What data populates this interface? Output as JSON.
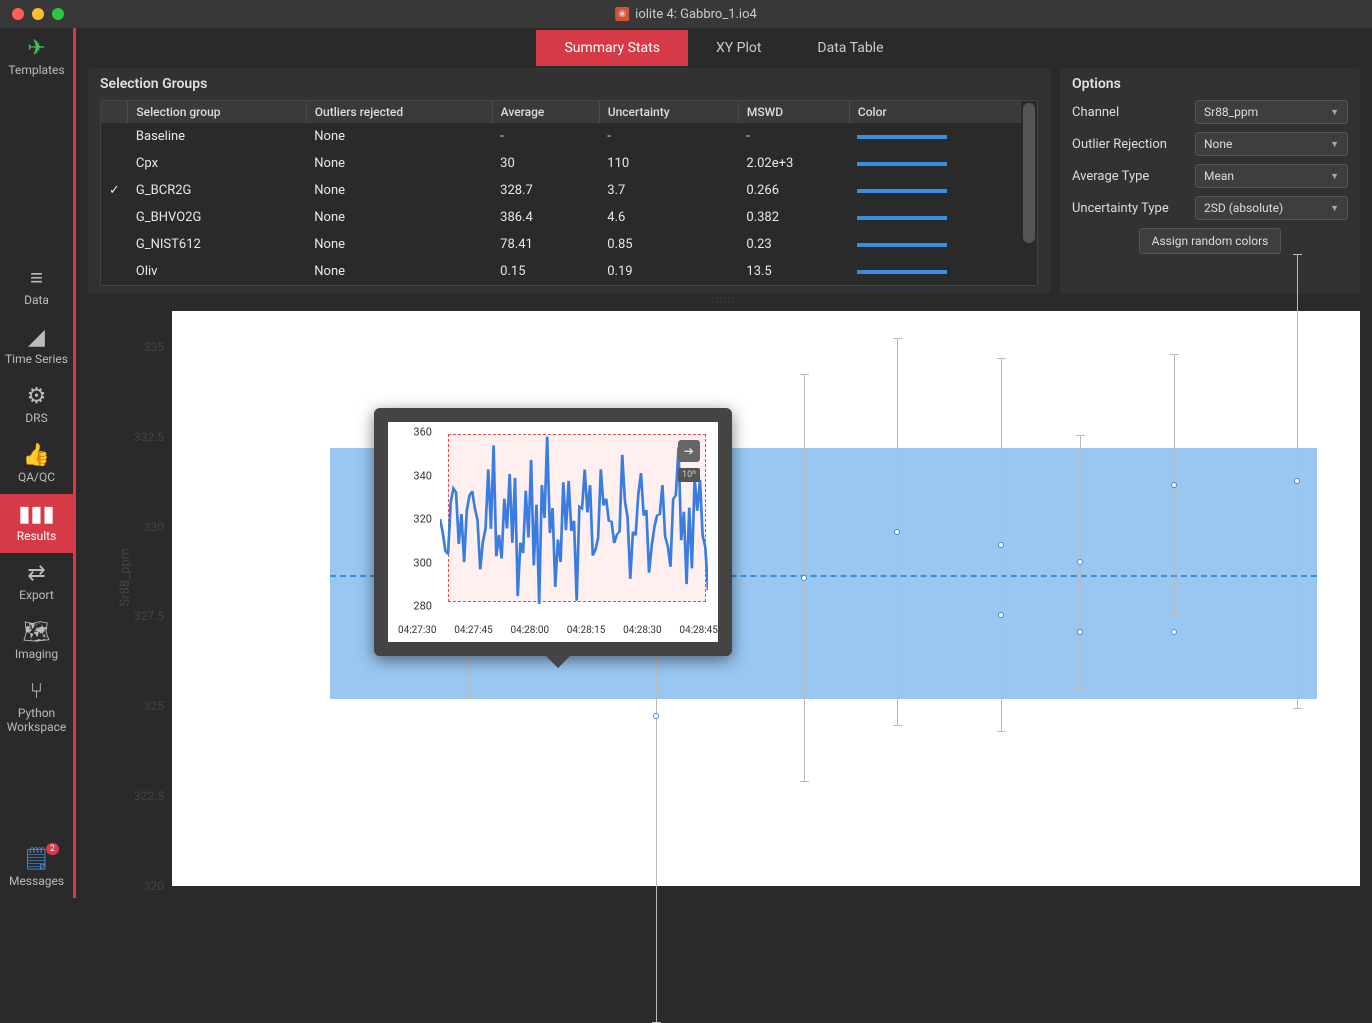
{
  "window": {
    "title": "iolite 4: Gabbro_1.io4"
  },
  "sidebar": {
    "items": [
      {
        "label": "Templates",
        "icon": "send"
      },
      {
        "label": "Data",
        "icon": "database"
      },
      {
        "label": "Time Series",
        "icon": "chart-area"
      },
      {
        "label": "DRS",
        "icon": "gear"
      },
      {
        "label": "QA/QC",
        "icon": "thumbs-up"
      },
      {
        "label": "Results",
        "icon": "bar-chart"
      },
      {
        "label": "Export",
        "icon": "exchange"
      },
      {
        "label": "Imaging",
        "icon": "map"
      },
      {
        "label": "Python Workspace",
        "icon": "code-fork"
      }
    ],
    "messages": {
      "label": "Messages",
      "badge": "2"
    }
  },
  "tabs": [
    {
      "label": "Summary Stats"
    },
    {
      "label": "XY Plot"
    },
    {
      "label": "Data Table"
    }
  ],
  "selection_groups": {
    "title": "Selection Groups",
    "headers": [
      "Selection group",
      "Outliers rejected",
      "Average",
      "Uncertainty",
      "MSWD",
      "Color"
    ],
    "rows": [
      {
        "checked": false,
        "group": "Baseline",
        "outliers": "None",
        "avg": "-",
        "unc": "-",
        "mswd": "-"
      },
      {
        "checked": false,
        "group": "Cpx",
        "outliers": "None",
        "avg": "30",
        "unc": "110",
        "mswd": "2.02e+3"
      },
      {
        "checked": true,
        "group": "G_BCR2G",
        "outliers": "None",
        "avg": "328.7",
        "unc": "3.7",
        "mswd": "0.266"
      },
      {
        "checked": false,
        "group": "G_BHVO2G",
        "outliers": "None",
        "avg": "386.4",
        "unc": "4.6",
        "mswd": "0.382"
      },
      {
        "checked": false,
        "group": "G_NIST612",
        "outliers": "None",
        "avg": "78.41",
        "unc": "0.85",
        "mswd": "0.23"
      },
      {
        "checked": false,
        "group": "Oliv",
        "outliers": "None",
        "avg": "0.15",
        "unc": "0.19",
        "mswd": "13.5"
      }
    ]
  },
  "options": {
    "title": "Options",
    "channel": {
      "label": "Channel",
      "value": "Sr88_ppm"
    },
    "outlier": {
      "label": "Outlier Rejection",
      "value": "None"
    },
    "avgtype": {
      "label": "Average Type",
      "value": "Mean"
    },
    "unctype": {
      "label": "Uncertainty Type",
      "value": "2SD (absolute)"
    },
    "assign_btn": "Assign random colors"
  },
  "chart_data": {
    "type": "scatter",
    "ylabel": "Sr88_ppm",
    "ylim": [
      320,
      336
    ],
    "yticks": [
      320,
      322.5,
      325,
      327.5,
      330,
      332.5,
      335
    ],
    "mean": 328.7,
    "band": [
      325,
      332.5
    ],
    "points": [
      {
        "x": 0.14,
        "y": 328.8,
        "err": 3.8
      },
      {
        "x": 0.33,
        "y": 324.5,
        "err": 9.2
      },
      {
        "x": 0.48,
        "y": 328.6,
        "err": 6.1
      },
      {
        "x": 0.575,
        "y": 330.0,
        "err": 5.8
      },
      {
        "x": 0.68,
        "y": 329.6,
        "err": 5.6
      },
      {
        "x": 0.76,
        "y": 329.1,
        "err": 3.8
      },
      {
        "x": 0.855,
        "y": 331.4,
        "err": 3.9
      },
      {
        "x": 0.98,
        "y": 331.5,
        "err": 6.8
      }
    ],
    "extra_points": [
      {
        "x": 0.205,
        "y": 330.8
      },
      {
        "x": 0.76,
        "y": 327
      },
      {
        "x": 0.855,
        "y": 327
      },
      {
        "x": 0.68,
        "y": 327.5
      }
    ],
    "tooltip": {
      "yticks": [
        280,
        300,
        320,
        340,
        360
      ],
      "xticks": [
        "04:27:30",
        "04:27:45",
        "04:28:00",
        "04:28:15",
        "04:28:30",
        "04:28:45"
      ],
      "badge": "10ⁿ"
    }
  }
}
